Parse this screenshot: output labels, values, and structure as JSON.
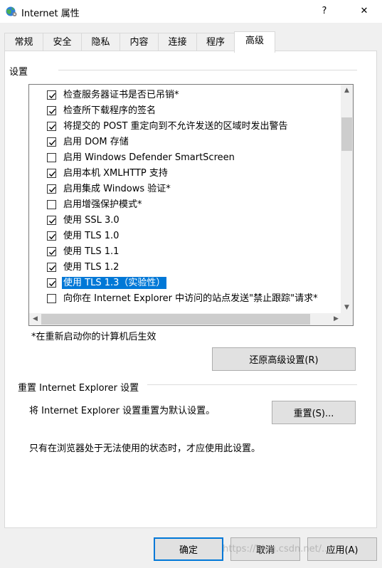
{
  "window": {
    "title": "Internet 属性",
    "help_label": "?",
    "close_label": "✕",
    "icon": "globe-settings-icon"
  },
  "tabs": [
    {
      "label": "常规",
      "active": false
    },
    {
      "label": "安全",
      "active": false
    },
    {
      "label": "隐私",
      "active": false
    },
    {
      "label": "内容",
      "active": false
    },
    {
      "label": "连接",
      "active": false
    },
    {
      "label": "程序",
      "active": false
    },
    {
      "label": "高级",
      "active": true
    }
  ],
  "settings": {
    "group_label": "设置",
    "items": [
      {
        "label": "检查服务器证书是否已吊销*",
        "checked": true,
        "selected": false
      },
      {
        "label": "检查所下载程序的签名",
        "checked": true,
        "selected": false
      },
      {
        "label": "将提交的 POST 重定向到不允许发送的区域时发出警告",
        "checked": true,
        "selected": false
      },
      {
        "label": "启用 DOM 存储",
        "checked": true,
        "selected": false
      },
      {
        "label": "启用 Windows Defender SmartScreen",
        "checked": false,
        "selected": false
      },
      {
        "label": "启用本机 XMLHTTP 支持",
        "checked": true,
        "selected": false
      },
      {
        "label": "启用集成 Windows 验证*",
        "checked": true,
        "selected": false
      },
      {
        "label": "启用增强保护模式*",
        "checked": false,
        "selected": false
      },
      {
        "label": "使用 SSL 3.0",
        "checked": true,
        "selected": false
      },
      {
        "label": "使用 TLS 1.0",
        "checked": true,
        "selected": false
      },
      {
        "label": "使用 TLS 1.1",
        "checked": true,
        "selected": false
      },
      {
        "label": "使用 TLS 1.2",
        "checked": true,
        "selected": false
      },
      {
        "label": "使用 TLS 1.3（实验性）",
        "checked": true,
        "selected": true
      },
      {
        "label": "向你在 Internet Explorer 中访问的站点发送\"禁止跟踪\"请求*",
        "checked": false,
        "selected": false
      }
    ],
    "restart_note": "*在重新启动你的计算机后生效",
    "restore_button": "还原高级设置(R)"
  },
  "reset": {
    "group_label": "重置 Internet Explorer 设置",
    "description": "将 Internet Explorer 设置重置为默认设置。",
    "button": "重置(S)...",
    "warning": "只有在浏览器处于无法使用的状态时，才应使用此设置。"
  },
  "footer": {
    "ok": "确定",
    "cancel": "取消",
    "apply": "应用(A)"
  },
  "watermark": "https://blog.csdn.net/...",
  "colors": {
    "selection": "#0078d7",
    "default_button_border": "#0078d7"
  }
}
